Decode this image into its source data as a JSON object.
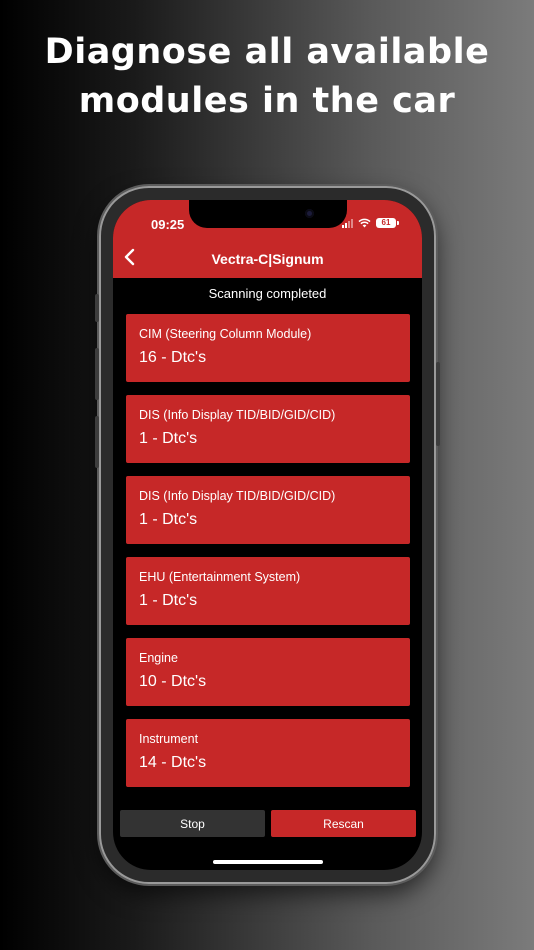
{
  "headline": {
    "line1": "Diagnose all available",
    "line2": "modules in the car"
  },
  "status_bar": {
    "time": "09:25",
    "battery": "61"
  },
  "nav": {
    "title": "Vectra-C|Signum",
    "back_icon": "chevron-left-icon"
  },
  "scan_status": "Scanning completed",
  "modules": [
    {
      "name": "CIM (Steering Column Module)",
      "count": "16 - Dtc's"
    },
    {
      "name": "DIS (Info Display TID/BID/GID/CID)",
      "count": "1 - Dtc's"
    },
    {
      "name": "DIS (Info Display TID/BID/GID/CID)",
      "count": "1 - Dtc's"
    },
    {
      "name": "EHU (Entertainment System)",
      "count": "1 - Dtc's"
    },
    {
      "name": "Engine",
      "count": "10 - Dtc's"
    },
    {
      "name": "Instrument",
      "count": "14 - Dtc's"
    }
  ],
  "buttons": {
    "stop": "Stop",
    "rescan": "Rescan"
  },
  "colors": {
    "accent": "#c62828",
    "stop_button": "#333333",
    "screen_bg": "#000000"
  }
}
